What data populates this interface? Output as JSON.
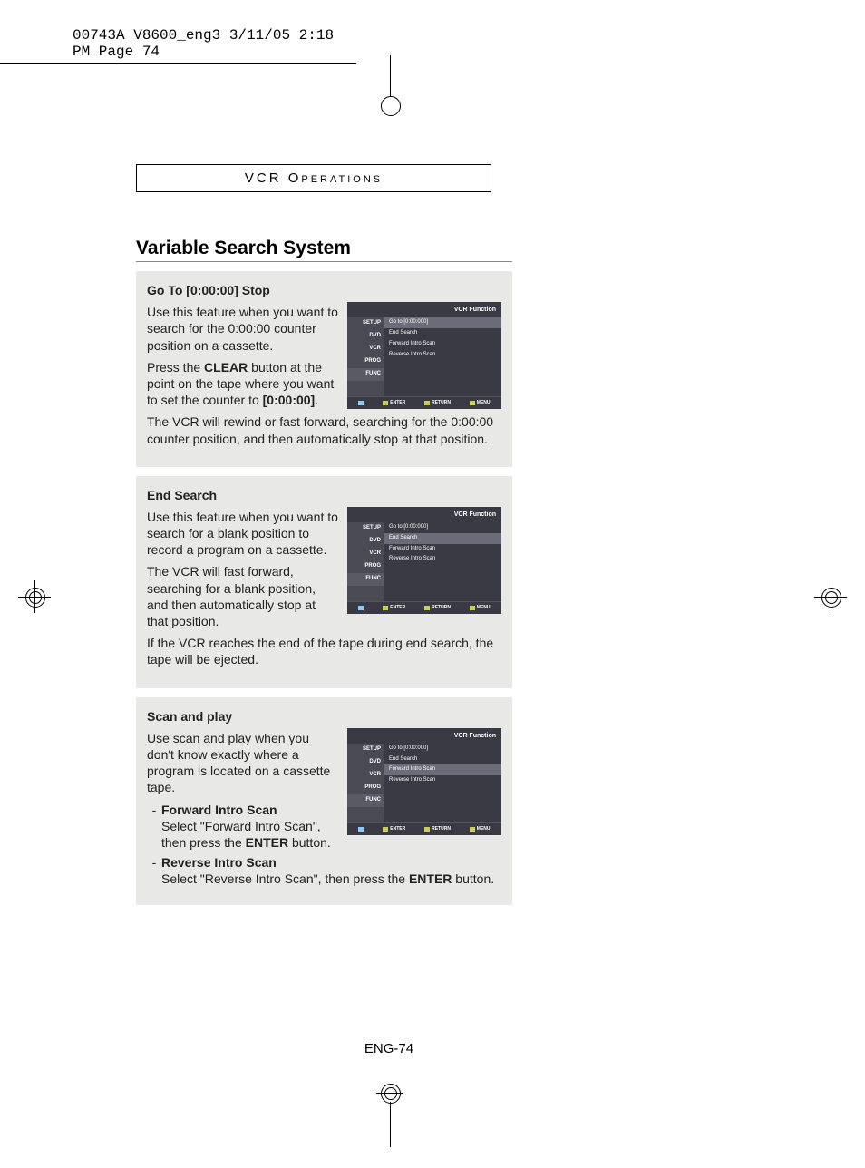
{
  "print_header": "00743A V8600_eng3  3/11/05  2:18 PM  Page 74",
  "section_header_prefix": "VCR ",
  "section_header_word": "Operations",
  "page_title": "Variable Search System",
  "page_number": "ENG-74",
  "osd_common": {
    "title": "VCR Function",
    "side": [
      "SETUP",
      "DVD",
      "VCR",
      "PROG",
      "FUNC"
    ],
    "items": [
      "Go to [0:00:000]",
      "End Search",
      "Forward Intro Scan",
      "Reverse Intro Scan"
    ],
    "footer": [
      "ENTER",
      "RETURN",
      "MENU"
    ]
  },
  "sections": [
    {
      "heading": "Go To [0:00:00] Stop",
      "osd_highlight": 0,
      "paras": [
        "Use this feature when you want to search for the 0:00:00 counter position on a cassette.",
        "Press the <b>CLEAR</b> button at the point on the tape where you want to set the counter to <b>[0:00:00]</b>.",
        "The VCR will rewind or fast forward, searching for the 0:00:00 counter position, and then automatically stop at that position."
      ]
    },
    {
      "heading": "End Search",
      "osd_highlight": 1,
      "paras": [
        "Use this feature when you want to search for a blank position to record a program on a cassette.",
        "The VCR will fast forward, searching for a blank position, and then automatically stop at that position.",
        "If the VCR reaches the end of the tape during end search, the tape will be ejected."
      ]
    },
    {
      "heading": "Scan and play",
      "osd_highlight": 2,
      "paras": [
        "Use scan and play when you don't know exactly where a program is located on a cassette tape."
      ],
      "list": [
        {
          "title": "Forward Intro Scan",
          "body": "Select \"Forward Intro Scan\", then press the <b>ENTER</b> button."
        },
        {
          "title": "Reverse Intro Scan",
          "body": "Select \"Reverse Intro Scan\", then press the <b>ENTER</b> button."
        }
      ]
    }
  ]
}
